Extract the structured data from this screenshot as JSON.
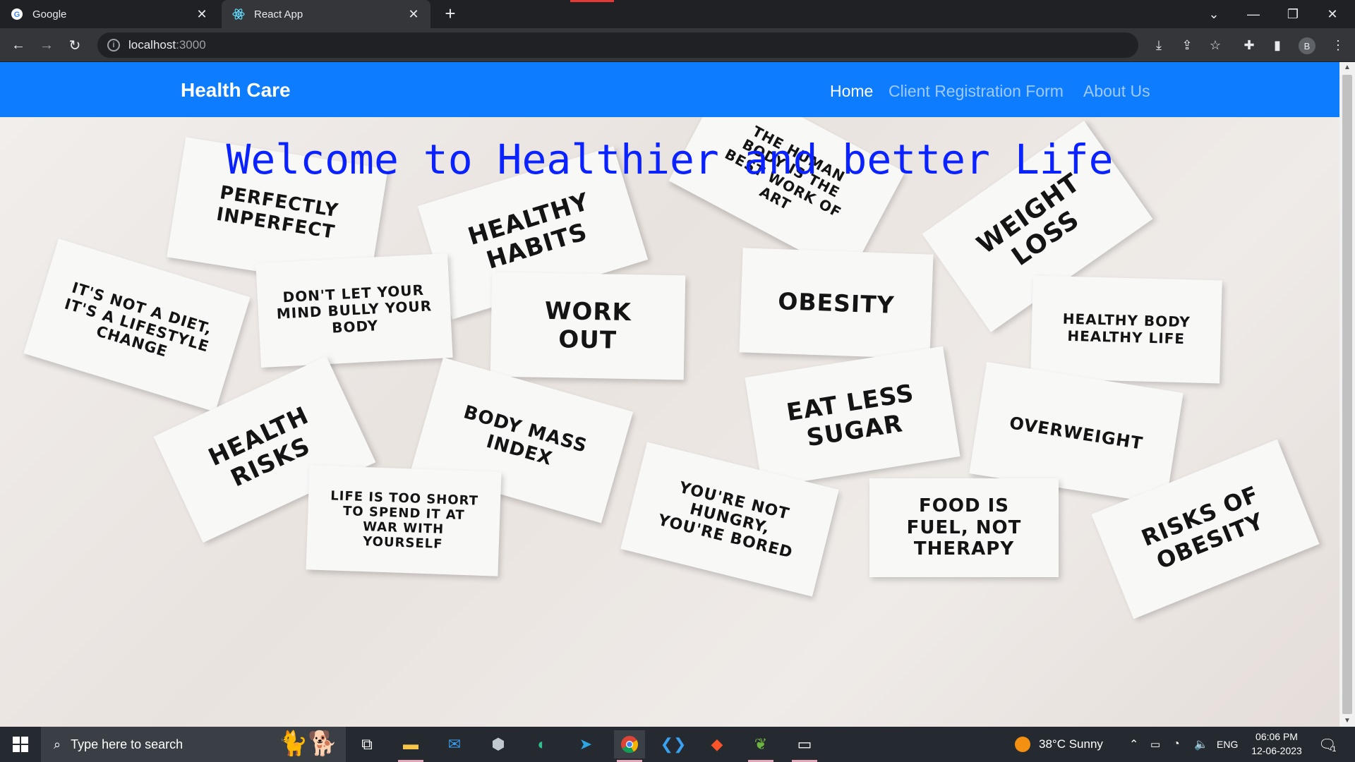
{
  "browser": {
    "tabs": [
      {
        "title": "Google",
        "icon": "google-icon"
      },
      {
        "title": "React App",
        "icon": "react-icon"
      }
    ],
    "url_host": "localhost",
    "url_port": ":3000",
    "profile_initial": "B"
  },
  "navbar": {
    "brand": "Health Care",
    "links": [
      "Home",
      "Client Registration Form",
      "About Us"
    ],
    "active": "Home",
    "color": "#0d7cff"
  },
  "hero": {
    "heading": "Welcome to Healthier and better Life",
    "heading_color": "#0a22ff"
  },
  "notes": [
    "PERFECTLY INPERFECT",
    "HEALTHY HABITS",
    "THE HUMAN BODY IS THE BEST WORK OF ART",
    "WEIGHT LOSS",
    "IT'S NOT A DIET, IT'S A LIFESTYLE CHANGE",
    "DON'T LET YOUR MIND BULLY YOUR BODY",
    "WORK OUT",
    "OBESITY",
    "HEALTHY BODY HEALTHY LIFE",
    "HEALTH RISKS",
    "BODY MASS INDEX",
    "EAT LESS SUGAR",
    "OVERWEIGHT",
    "LIFE IS TOO SHORT TO SPEND IT AT WAR WITH YOURSELF",
    "YOU'RE NOT HUNGRY, YOU'RE BORED",
    "FOOD IS FUEL, NOT THERAPY",
    "RISKS OF OBESITY"
  ],
  "taskbar": {
    "search_placeholder": "Type here to search",
    "weather": "38°C  Sunny",
    "language": "ENG",
    "time": "06:06 PM",
    "date": "12-06-2023",
    "notification_count": "1"
  }
}
